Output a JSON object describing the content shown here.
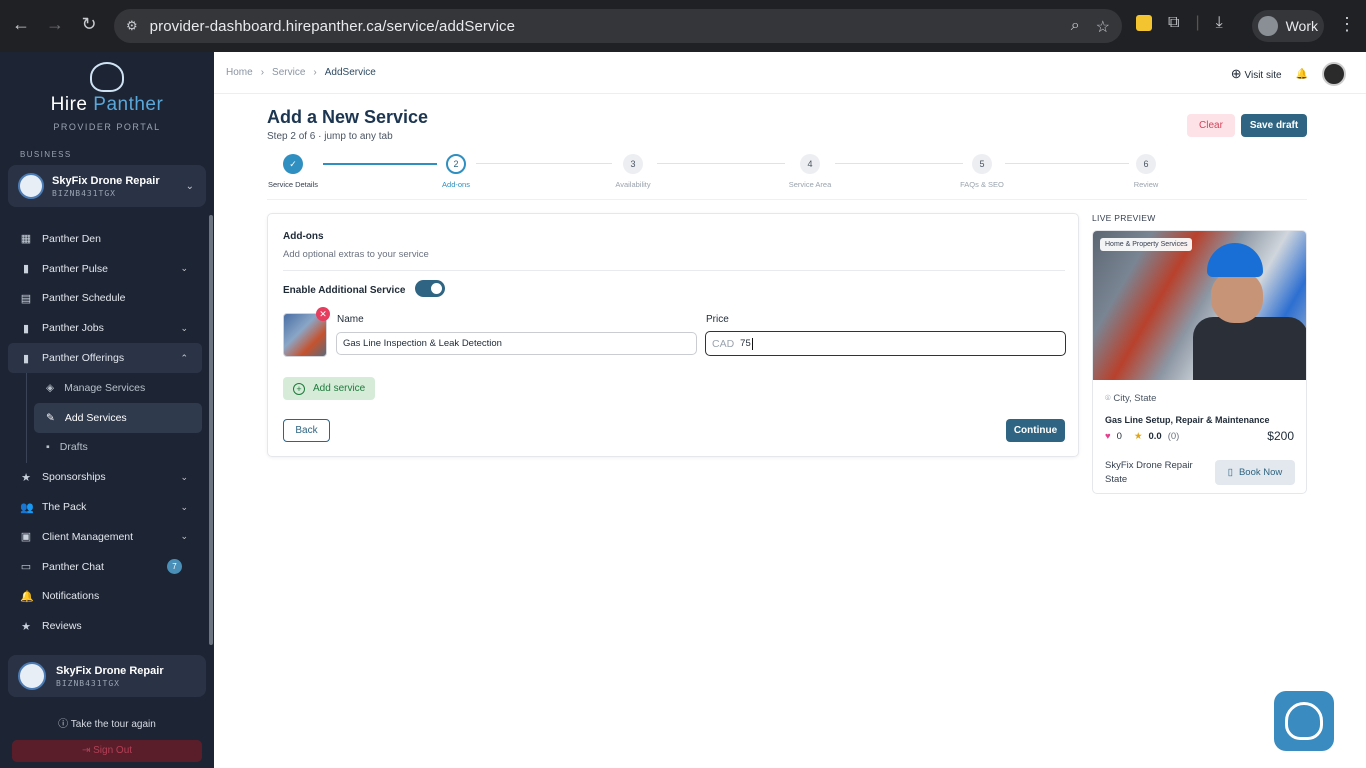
{
  "browser": {
    "url": "provider-dashboard.hirepanther.ca/service/addService",
    "profile": "Work"
  },
  "sidebar": {
    "brand_a": "Hire",
    "brand_b": "Panther",
    "brand_sub": "PROVIDER PORTAL",
    "section_label": "BUSINESS",
    "business_name": "SkyFix Drone Repair",
    "business_code": "BIZNB431TGX",
    "items": [
      {
        "label": "Panther Den"
      },
      {
        "label": "Panther Pulse"
      },
      {
        "label": "Panther Schedule"
      },
      {
        "label": "Panther Jobs"
      },
      {
        "label": "Panther Offerings"
      },
      {
        "label": "Sponsorships"
      },
      {
        "label": "The Pack"
      },
      {
        "label": "Client Management"
      },
      {
        "label": "Panther Chat",
        "badge": "7"
      },
      {
        "label": "Notifications"
      },
      {
        "label": "Reviews"
      }
    ],
    "sub_items": [
      {
        "label": "Manage Services"
      },
      {
        "label": "Add Services"
      },
      {
        "label": "Drafts"
      }
    ],
    "user_name": "SkyFix Drone Repair",
    "user_code": "BIZNB431TGX",
    "tour": "Take the tour again",
    "signout": "Sign Out"
  },
  "topbar": {
    "crumbs": [
      "Home",
      "Service",
      "AddService"
    ],
    "visit_site": "Visit site"
  },
  "header": {
    "title": "Add a New Service",
    "subtitle": "Step 2 of 6 · jump to any tab",
    "clear": "Clear",
    "save_draft": "Save draft"
  },
  "steps": [
    {
      "num": "✓",
      "label": "Service Details"
    },
    {
      "num": "2",
      "label": "Add-ons"
    },
    {
      "num": "3",
      "label": "Availability"
    },
    {
      "num": "4",
      "label": "Service Area"
    },
    {
      "num": "5",
      "label": "FAQs & SEO"
    },
    {
      "num": "6",
      "label": "Review"
    }
  ],
  "addons": {
    "title": "Add-ons",
    "desc": "Add optional extras to your service",
    "toggle_label": "Enable Additional Service",
    "toggle_on": true,
    "name_label": "Name",
    "name_value": "Gas Line Inspection & Leak Detection",
    "price_label": "Price",
    "currency": "CAD",
    "price_value": "75",
    "add_service": "Add service",
    "back": "Back",
    "continue": "Continue"
  },
  "preview": {
    "label": "LIVE PREVIEW",
    "tag": "Home & Property Services",
    "location": "City, State",
    "title": "Gas Line Setup, Repair & Maintenance",
    "likes": "0",
    "rating": "0.0",
    "reviews": "(0)",
    "price": "$200",
    "business": "SkyFix Drone Repair State",
    "book": "Book Now"
  },
  "colors": {
    "primary": "#2f6582",
    "accent": "#2f8fc0",
    "sidebar_bg": "#1d2433"
  }
}
